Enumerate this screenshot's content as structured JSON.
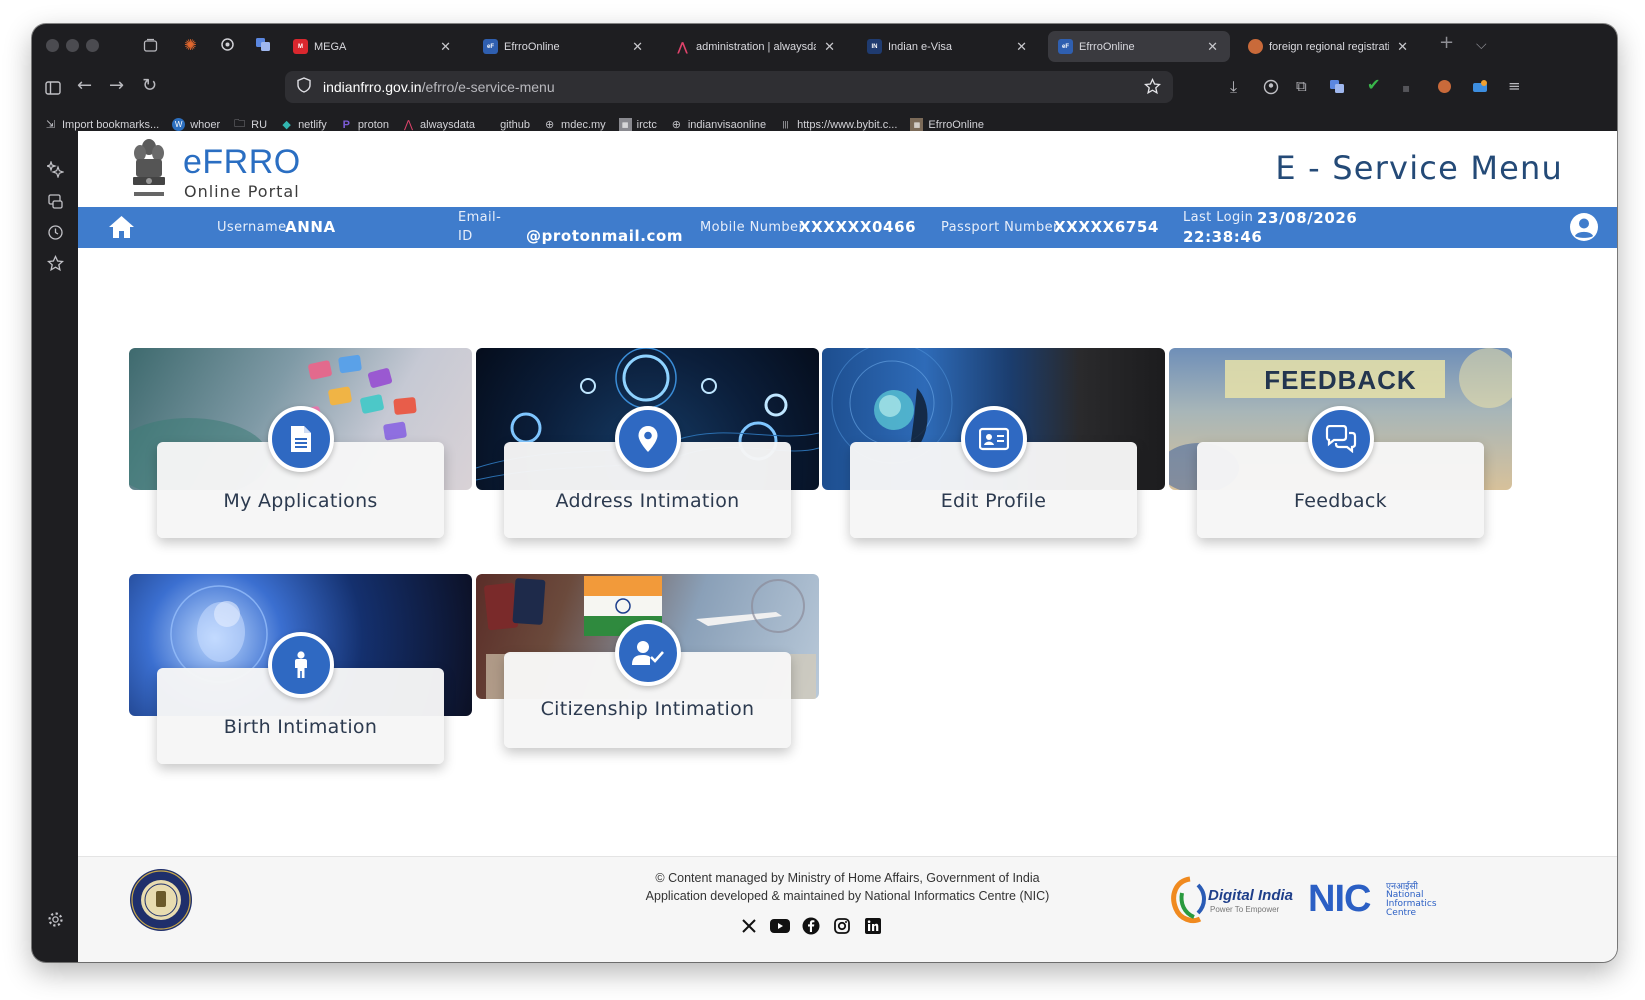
{
  "browser": {
    "tabs": [
      {
        "title": "MEGA",
        "favicon": "mega-icon",
        "color": "#d9272e",
        "active": false
      },
      {
        "title": "EfrroOnline",
        "favicon": "efrro-icon",
        "color": "#2f5fb0",
        "active": false
      },
      {
        "title": "administration | alwaysdata",
        "favicon": "alwaysdata-icon",
        "color": "#e0436b",
        "active": false
      },
      {
        "title": "Indian e-Visa",
        "favicon": "evisa-icon",
        "color": "#1f3b70",
        "active": false
      },
      {
        "title": "EfrroOnline",
        "favicon": "efrro-icon",
        "color": "#2f5fb0",
        "active": true
      },
      {
        "title": "foreign regional registration c",
        "favicon": "claude-icon",
        "color": "#c96a3a",
        "active": false
      }
    ],
    "url_host": "indianfrro.gov.in",
    "url_path": "/efrro/e-service-menu",
    "bookmarks": [
      {
        "label": "Import bookmarks...",
        "icon": "import-icon"
      },
      {
        "label": "whoer",
        "icon": "whoer-icon"
      },
      {
        "label": "RU",
        "icon": "folder-icon"
      },
      {
        "label": "netlify",
        "icon": "netlify-icon"
      },
      {
        "label": "proton",
        "icon": "proton-icon"
      },
      {
        "label": "alwaysdata",
        "icon": "alwaysdata-icon"
      },
      {
        "label": "github",
        "icon": "github-icon"
      },
      {
        "label": "mdec.my",
        "icon": "globe-icon"
      },
      {
        "label": "irctc",
        "icon": "irctc-icon"
      },
      {
        "label": "indianvisaonline",
        "icon": "globe-icon"
      },
      {
        "label": "https://www.bybit.c...",
        "icon": "bybit-icon"
      },
      {
        "label": "EfrroOnline",
        "icon": "efrro-icon"
      }
    ]
  },
  "header": {
    "logo_title": "eFRRO",
    "logo_subtitle": "Online Portal",
    "page_title": "E - Service Menu"
  },
  "info": {
    "username_label": "Username",
    "username": "ANNA",
    "email_label_line1": "Email-",
    "email_label_line2": "ID",
    "email": "@protonmail.com",
    "mobile_label": "Mobile Number",
    "mobile": "XXXXXX0466",
    "passport_label": "Passport Number",
    "passport": "XXXXX6754",
    "last_login_label": "Last Login",
    "last_login_date": "23/08/2026",
    "last_login_time": "22:38:46"
  },
  "cards": [
    {
      "label": "My Applications",
      "icon": "document-icon"
    },
    {
      "label": "Address Intimation",
      "icon": "map-pin-icon"
    },
    {
      "label": "Edit Profile",
      "icon": "id-card-icon"
    },
    {
      "label": "Feedback",
      "icon": "chat-bubbles-icon",
      "banner_text": "FEEDBACK"
    },
    {
      "label": "Birth Intimation",
      "icon": "child-icon"
    },
    {
      "label": "Citizenship Intimation",
      "icon": "user-check-icon"
    }
  ],
  "footer": {
    "line1": "© Content managed by Ministry of Home Affairs, Government of India",
    "line2": "Application developed & maintained by National Informatics Centre (NIC)",
    "social": [
      "x-icon",
      "youtube-icon",
      "facebook-icon",
      "instagram-icon",
      "linkedin-icon"
    ],
    "digital_india": "Digital India",
    "digital_india_tagline": "Power To Empower",
    "nic_hindi": "एनआईसी",
    "nic_line1": "National",
    "nic_line2": "Informatics",
    "nic_line3": "Centre"
  },
  "colors": {
    "brand_blue": "#3f7ccc",
    "icon_circle": "#2f69c2",
    "title_navy": "#244a77"
  }
}
